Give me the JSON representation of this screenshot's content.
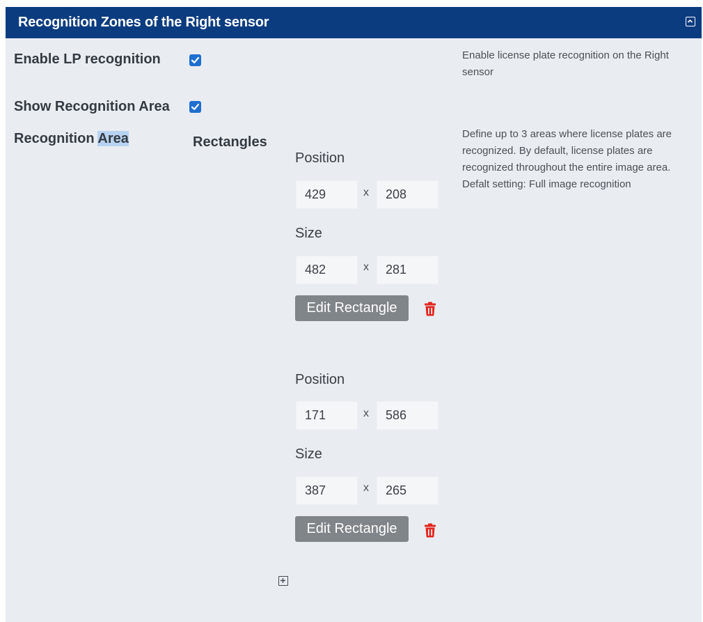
{
  "panel": {
    "title": "Recognition Zones of the Right sensor",
    "collapse_icon": "collapse-icon"
  },
  "colors": {
    "header_bg": "#0b3c80",
    "panel_bg": "#e9edf1",
    "checkbox": "#1f6fd1",
    "edit_button": "#808589",
    "trash": "#e3261f"
  },
  "settings": {
    "enable_lp": {
      "label": "Enable LP recognition",
      "checked": true,
      "help": "Enable license plate recognition on the Right sensor"
    },
    "show_area": {
      "label": "Show Recognition Area",
      "checked": true
    },
    "area": {
      "label_prefix": "Recognition ",
      "label_highlight": "Area",
      "rectangles_label": "Rectangles",
      "help": "Define up to 3 areas where license plates are recognized. By default, license plates are recognized throughout the entire image area. Defalt setting: Full image recognition"
    }
  },
  "rectangles": [
    {
      "position_label": "Position",
      "position_x": "429",
      "position_y": "208",
      "size_label": "Size",
      "size_w": "482",
      "size_h": "281",
      "separator": "x",
      "edit_label": "Edit Rectangle",
      "delete_icon": "trash-icon"
    },
    {
      "position_label": "Position",
      "position_x": "171",
      "position_y": "586",
      "size_label": "Size",
      "size_w": "387",
      "size_h": "265",
      "separator": "x",
      "edit_label": "Edit Rectangle",
      "delete_icon": "trash-icon"
    }
  ],
  "add_icon": "plus-box-icon"
}
